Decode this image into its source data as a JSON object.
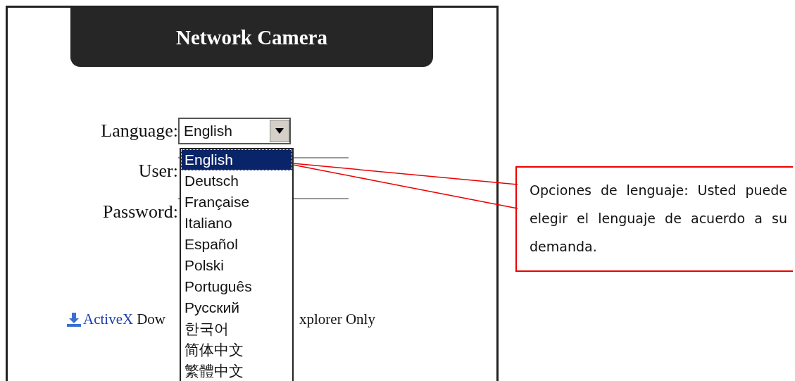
{
  "header": {
    "title": "Network Camera"
  },
  "form": {
    "fields": [
      {
        "kind": "select",
        "label": "Language:",
        "value": "English"
      },
      {
        "kind": "input",
        "label": "User:"
      },
      {
        "kind": "input",
        "label": "Password:"
      }
    ]
  },
  "dropdown": {
    "options": [
      {
        "label": "English",
        "selected": true
      },
      {
        "label": "Deutsch",
        "selected": false
      },
      {
        "label": "Française",
        "selected": false
      },
      {
        "label": "Italiano",
        "selected": false
      },
      {
        "label": "Español",
        "selected": false
      },
      {
        "label": "Polski",
        "selected": false
      },
      {
        "label": "Português",
        "selected": false
      },
      {
        "label": "Русский",
        "selected": false
      },
      {
        "label": "한국어",
        "selected": false
      },
      {
        "label": "简体中文",
        "selected": false
      },
      {
        "label": "繁體中文",
        "selected": false
      }
    ]
  },
  "download": {
    "link": "ActiveX",
    "text_left": "Dow",
    "text_right": "xplorer Only"
  },
  "callout": {
    "text": "Opciones de lenguaje: Usted puede elegir el lenguaje de acuerdo a su demanda."
  }
}
